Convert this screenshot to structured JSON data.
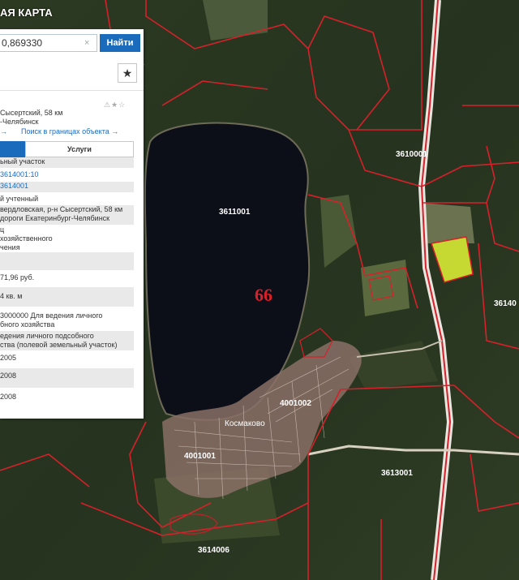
{
  "header": {
    "brand": "АЯ КАРТА"
  },
  "search": {
    "value": "0,869330",
    "clear_glyph": "×",
    "button_label": "Найти",
    "favorite_icon": "star-icon"
  },
  "card": {
    "status_icons": "⚠★☆",
    "address_line1": "Сысертский, 58 км",
    "address_line2": "-Челябинск",
    "link_arrow": "→",
    "link_search": "Поиск в границах объекта →",
    "tab_services": "Услуги"
  },
  "info_rows": [
    {
      "text": "ьный участок"
    },
    {
      "text": "3614001:10"
    },
    {
      "text": "3614001"
    },
    {
      "text": "й учтенный"
    },
    {
      "text": "вердловская, р-н Сысертский, 58 км"
    },
    {
      "text": "дороги Екатеринбург-Челябинск"
    },
    {
      "text": "ц"
    },
    {
      "text": "хозяйственного"
    },
    {
      "text": "чения"
    },
    {
      "text": "71,96 руб."
    },
    {
      "text": "4 кв. м"
    },
    {
      "text": "3000000 Для ведения личного"
    },
    {
      "text": "бного хозяйства"
    },
    {
      "text": "едения личного подсобного"
    },
    {
      "text": "ства (полевой земельный участок)"
    },
    {
      "text": "2005"
    },
    {
      "text": "2008"
    },
    {
      "text": "2008"
    }
  ],
  "map_labels": {
    "lake_block": "3611001",
    "region": "66",
    "ne_block": "3610001",
    "e_block": "36140",
    "village_block": "4001002",
    "village_name": "Космаково",
    "sw_block": "4001001",
    "se_block": "3613001",
    "s_block": "3614006"
  },
  "colors": {
    "boundary": "#d8202a",
    "accent": "#1b6bbd",
    "selected_parcel": "#c6d832"
  }
}
